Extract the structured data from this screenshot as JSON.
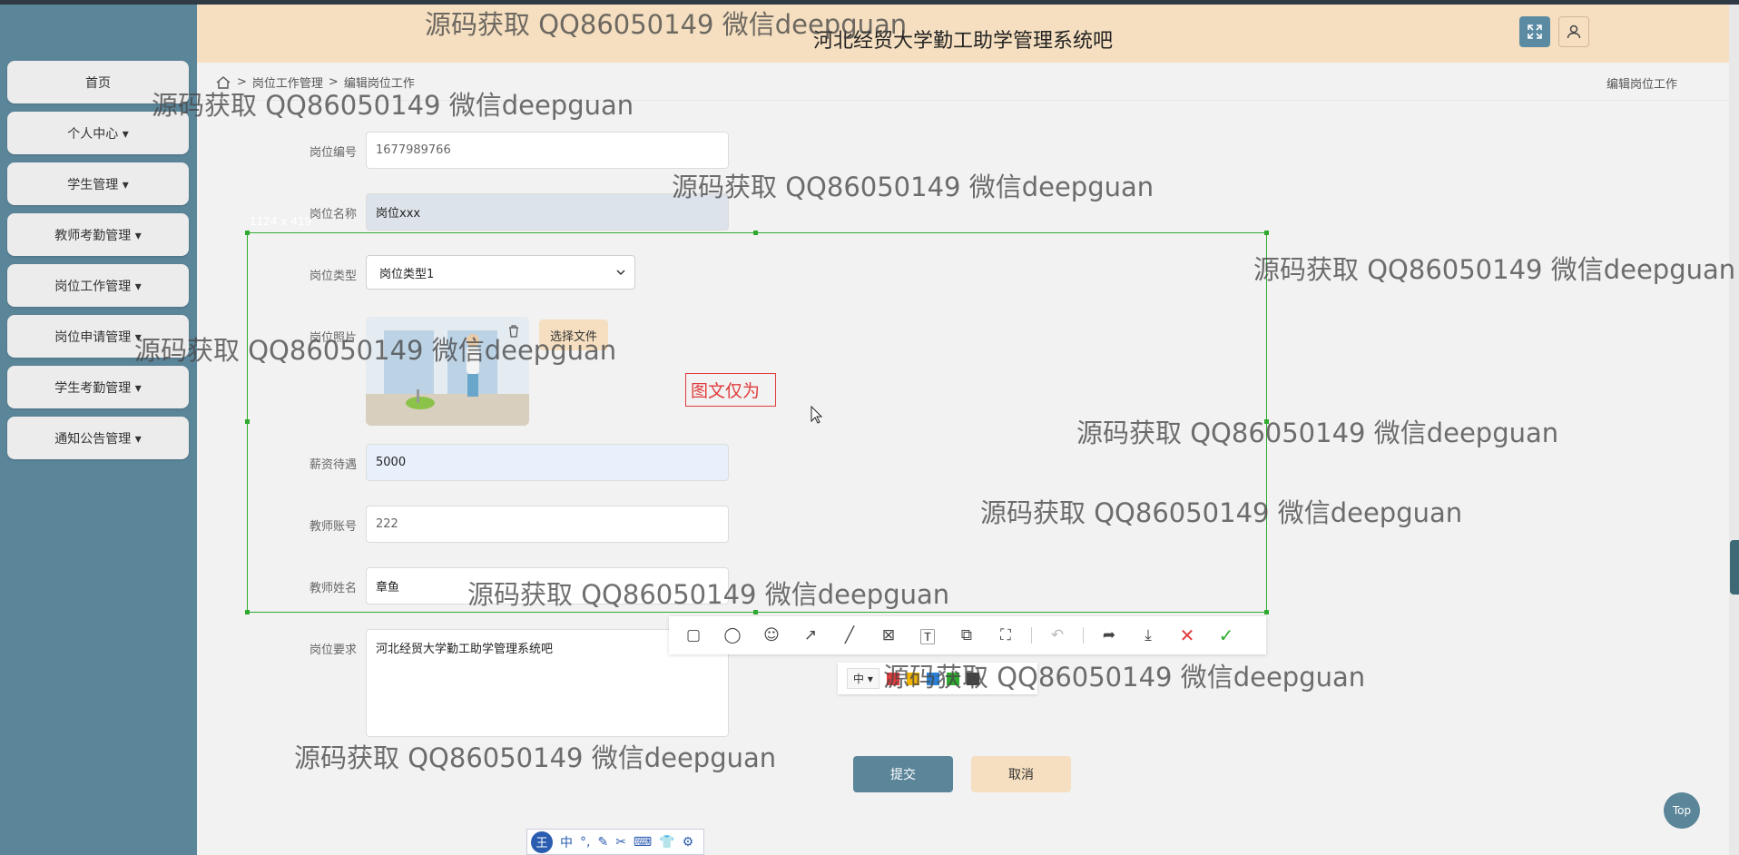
{
  "app": {
    "title": "河北经贸大学勤工助学管理系统吧"
  },
  "sidebar": {
    "items": [
      {
        "label": "首页"
      },
      {
        "label": "个人中心 ▾"
      },
      {
        "label": "学生管理 ▾"
      },
      {
        "label": "教师考勤管理 ▾"
      },
      {
        "label": "岗位工作管理 ▾"
      },
      {
        "label": "岗位申请管理 ▾"
      },
      {
        "label": "学生考勤管理 ▾"
      },
      {
        "label": "通知公告管理 ▾"
      }
    ]
  },
  "breadcrumb": {
    "sep1": ">",
    "parent": "岗位工作管理",
    "sep2": ">",
    "current": "编辑岗位工作",
    "right": "编辑岗位工作"
  },
  "form": {
    "job_no": {
      "label": "岗位编号",
      "value": "1677989766"
    },
    "job_name": {
      "label": "岗位名称",
      "value": "岗位xxx"
    },
    "job_type": {
      "label": "岗位类型",
      "value": "岗位类型1"
    },
    "job_photo": {
      "label": "岗位照片",
      "choose_label": "选择文件"
    },
    "salary": {
      "label": "薪资待遇",
      "value": "5000"
    },
    "teacher_account": {
      "label": "教师账号",
      "value": "222"
    },
    "teacher_name": {
      "label": "教师姓名",
      "value": "章鱼"
    },
    "requirements": {
      "label": "岗位要求",
      "value": "河北经贸大学勤工助学管理系统吧"
    },
    "submit_label": "提交",
    "cancel_label": "取消"
  },
  "top_button": {
    "label": "Top"
  },
  "capture": {
    "size": "1124 x 419",
    "annotation_text": "图文仅为",
    "font_size_option": "中 ▾",
    "colors": [
      "#e03c3c",
      "#f0b400",
      "#2a7fd4",
      "#2eaa2e",
      "#444444"
    ]
  },
  "ime": {
    "logo": "王",
    "items": [
      "中",
      "°,",
      "✎",
      "✂",
      "⌨",
      "👕",
      "⚙"
    ]
  },
  "watermark": "源码获取 QQ86050149 微信deepguan"
}
